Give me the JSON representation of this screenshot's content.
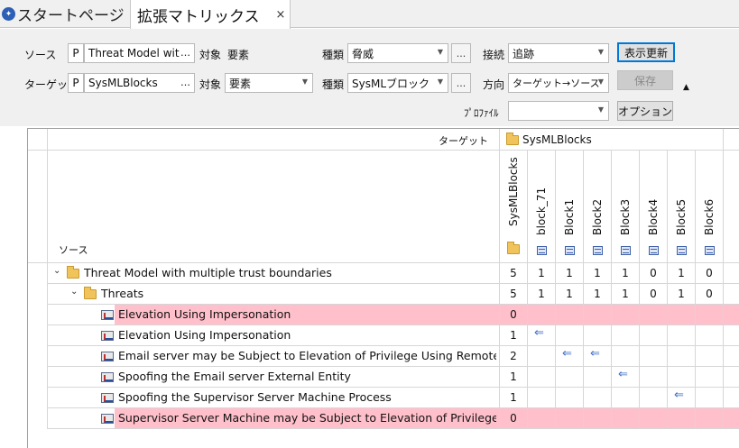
{
  "tabs": {
    "start": "スタートページ",
    "matrix": "拡張マトリックス",
    "close": "×"
  },
  "toolbar": {
    "source_label": "ソース",
    "target_label": "ターゲット",
    "p": "P",
    "source_value": "Threat Model wit",
    "target_value": "SysMLBlocks",
    "dots": "…",
    "object_label": "対象",
    "source_object": "要素",
    "target_object": "要素",
    "kind_label": "種類",
    "source_kind": "脅威",
    "target_kind": "SysMLブロック",
    "ellipsis_btn": "...",
    "link_label": "接続",
    "link_value": "追跡",
    "direction_label": "方向",
    "direction_value": "ターゲット→ソース",
    "profile_label": "ﾌﾟﾛﾌｧｲﾙ",
    "profile_value": "",
    "refresh_btn": "表示更新",
    "save_btn": "保存",
    "options_btn": "オプション",
    "collapse_glyph": "▲"
  },
  "matrix": {
    "target_header": "ターゲット",
    "target_package": "SysMLBlocks",
    "source_header": "ソース",
    "columns": [
      "SysMLBlocks",
      "block_71",
      "Block1",
      "Block2",
      "Block3",
      "Block4",
      "Block5",
      "Block6"
    ],
    "arrow_glyph": "⇐",
    "rows": [
      {
        "label": "Threat Model with multiple trust boundaries",
        "kind": "package",
        "level": 0,
        "expand": "⌄",
        "highlight": false,
        "cells": [
          "5",
          "1",
          "1",
          "1",
          "1",
          "0",
          "1",
          "0"
        ]
      },
      {
        "label": "Threats",
        "kind": "package",
        "level": 1,
        "expand": "⌄",
        "highlight": false,
        "cells": [
          "5",
          "1",
          "1",
          "1",
          "1",
          "0",
          "1",
          "0"
        ]
      },
      {
        "label": "Elevation Using Impersonation",
        "kind": "threat",
        "level": 2,
        "expand": "",
        "highlight": true,
        "cells": [
          "0",
          "",
          "",
          "",
          "",
          "",
          "",
          ""
        ]
      },
      {
        "label": "Elevation Using Impersonation",
        "kind": "threat",
        "level": 2,
        "expand": "",
        "highlight": false,
        "cells": [
          "1",
          "arrow",
          "",
          "",
          "",
          "",
          "",
          ""
        ]
      },
      {
        "label": "Email server may be Subject to Elevation of Privilege Using Remote C…",
        "kind": "threat",
        "level": 2,
        "expand": "",
        "highlight": false,
        "cells": [
          "2",
          "",
          "arrow",
          "arrow",
          "",
          "",
          "",
          ""
        ]
      },
      {
        "label": "Spoofing the Email server External Entity",
        "kind": "threat",
        "level": 2,
        "expand": "",
        "highlight": false,
        "cells": [
          "1",
          "",
          "",
          "",
          "arrow",
          "",
          "",
          ""
        ]
      },
      {
        "label": "Spoofing the Supervisor Server Machine Process",
        "kind": "threat",
        "level": 2,
        "expand": "",
        "highlight": false,
        "cells": [
          "1",
          "",
          "",
          "",
          "",
          "",
          "arrow",
          ""
        ]
      },
      {
        "label": "Supervisor Server Machine may be Subject to Elevation of Privilege U…",
        "kind": "threat",
        "level": 2,
        "expand": "",
        "highlight": true,
        "cells": [
          "0",
          "",
          "",
          "",
          "",
          "",
          "",
          ""
        ]
      }
    ]
  },
  "colors": {
    "highlight": "#ffc0cb",
    "arrow": "#3a6cc6",
    "accent": "#0078d7"
  }
}
